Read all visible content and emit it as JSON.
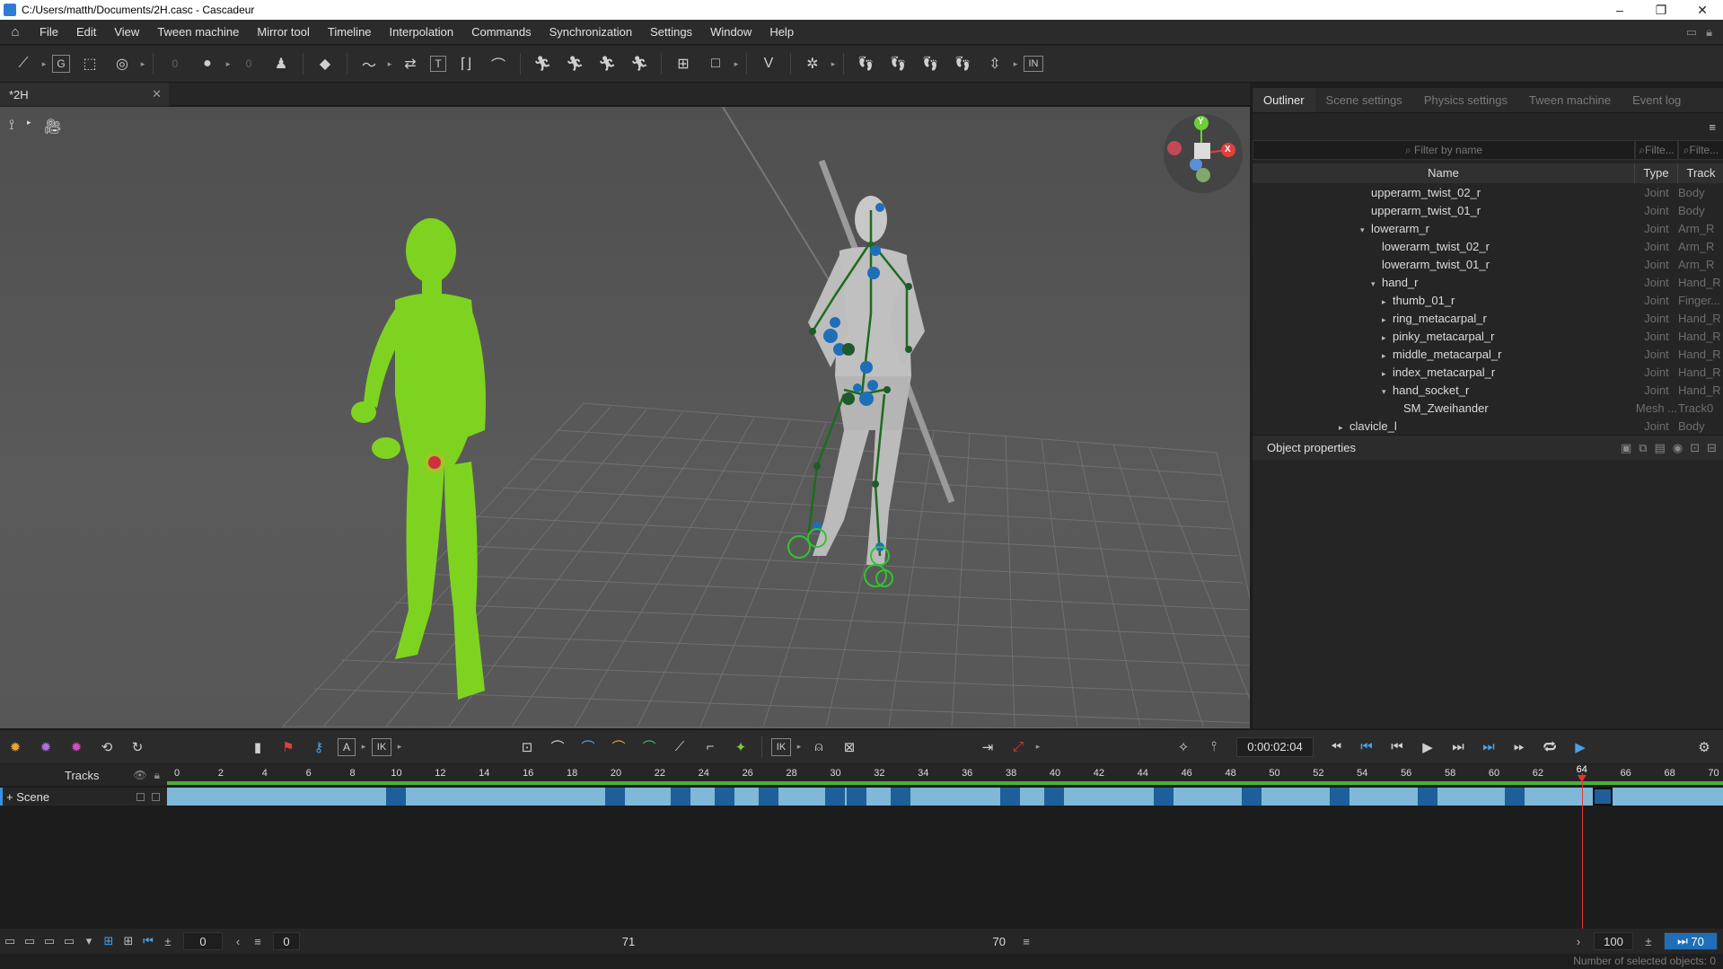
{
  "window": {
    "title": "C:/Users/matth/Documents/2H.casc - Cascadeur",
    "controls": [
      "–",
      "❐",
      "✕"
    ]
  },
  "menu": [
    "File",
    "Edit",
    "View",
    "Tween machine",
    "Mirror tool",
    "Timeline",
    "Interpolation",
    "Commands",
    "Synchronization",
    "Settings",
    "Window",
    "Help"
  ],
  "toolbar": {
    "field_a": "0",
    "field_b": "0",
    "g_label": "G",
    "t_label": "T",
    "in_label": "IN"
  },
  "document_tab": {
    "label": "*2H",
    "close": "✕"
  },
  "viewport": {
    "gizmo": {
      "y": "Y",
      "x": "X"
    },
    "character_colors": {
      "green": "#7ed321",
      "rig": "#c8c8c8"
    }
  },
  "right_panel": {
    "tabs": [
      "Outliner",
      "Scene settings",
      "Physics settings",
      "Tween machine",
      "Event log"
    ],
    "filter_placeholder": "Filter by name",
    "filter_short_1": "Filte...",
    "filter_short_2": "Filte...",
    "columns": {
      "name": "Name",
      "type": "Type",
      "track": "Track"
    },
    "rows": [
      {
        "name": "upperarm_twist_02_r",
        "type": "Joint",
        "track": "Body",
        "indent": 10,
        "caret": ""
      },
      {
        "name": "upperarm_twist_01_r",
        "type": "Joint",
        "track": "Body",
        "indent": 10,
        "caret": ""
      },
      {
        "name": "lowerarm_r",
        "type": "Joint",
        "track": "Arm_R",
        "indent": 10,
        "caret": "▾"
      },
      {
        "name": "lowerarm_twist_02_r",
        "type": "Joint",
        "track": "Arm_R",
        "indent": 11,
        "caret": ""
      },
      {
        "name": "lowerarm_twist_01_r",
        "type": "Joint",
        "track": "Arm_R",
        "indent": 11,
        "caret": ""
      },
      {
        "name": "hand_r",
        "type": "Joint",
        "track": "Hand_R",
        "indent": 11,
        "caret": "▾"
      },
      {
        "name": "thumb_01_r",
        "type": "Joint",
        "track": "Finger...",
        "indent": 12,
        "caret": "▸"
      },
      {
        "name": "ring_metacarpal_r",
        "type": "Joint",
        "track": "Hand_R",
        "indent": 12,
        "caret": "▸"
      },
      {
        "name": "pinky_metacarpal_r",
        "type": "Joint",
        "track": "Hand_R",
        "indent": 12,
        "caret": "▸"
      },
      {
        "name": "middle_metacarpal_r",
        "type": "Joint",
        "track": "Hand_R",
        "indent": 12,
        "caret": "▸"
      },
      {
        "name": "index_metacarpal_r",
        "type": "Joint",
        "track": "Hand_R",
        "indent": 12,
        "caret": "▸"
      },
      {
        "name": "hand_socket_r",
        "type": "Joint",
        "track": "Hand_R",
        "indent": 12,
        "caret": "▾"
      },
      {
        "name": "SM_Zweihander",
        "type": "Mesh ...",
        "track": "Track0",
        "indent": 13,
        "caret": ""
      },
      {
        "name": "clavicle_l",
        "type": "Joint",
        "track": "Body",
        "indent": 8,
        "caret": "▸"
      }
    ],
    "object_properties": "Object properties"
  },
  "timeline_toolbar": {
    "a_label": "A",
    "ik_label": "IK",
    "ik2_label": "IK",
    "time": "0:00:02:04"
  },
  "timeline": {
    "tracks_label": "Tracks",
    "scene_label": "+ Scene",
    "ticks": [
      "0",
      "2",
      "4",
      "6",
      "8",
      "10",
      "12",
      "14",
      "16",
      "18",
      "20",
      "22",
      "24",
      "26",
      "28",
      "30",
      "32",
      "34",
      "36",
      "38",
      "40",
      "42",
      "44",
      "46",
      "48",
      "50",
      "52",
      "54",
      "56",
      "58",
      "60",
      "62",
      "64",
      "66",
      "68",
      "70"
    ],
    "current_frame": "64",
    "current_frame_value": 64,
    "keyframes": [
      10,
      20,
      23,
      25,
      27,
      30,
      31,
      33,
      38,
      40,
      45,
      49,
      53,
      57,
      61,
      65
    ]
  },
  "bottom": {
    "start_field": "0",
    "offset_field": "0",
    "center_value": "71",
    "end_value": "70",
    "fps_field": "100",
    "end_field": "70"
  },
  "status": "Number of selected objects: 0"
}
